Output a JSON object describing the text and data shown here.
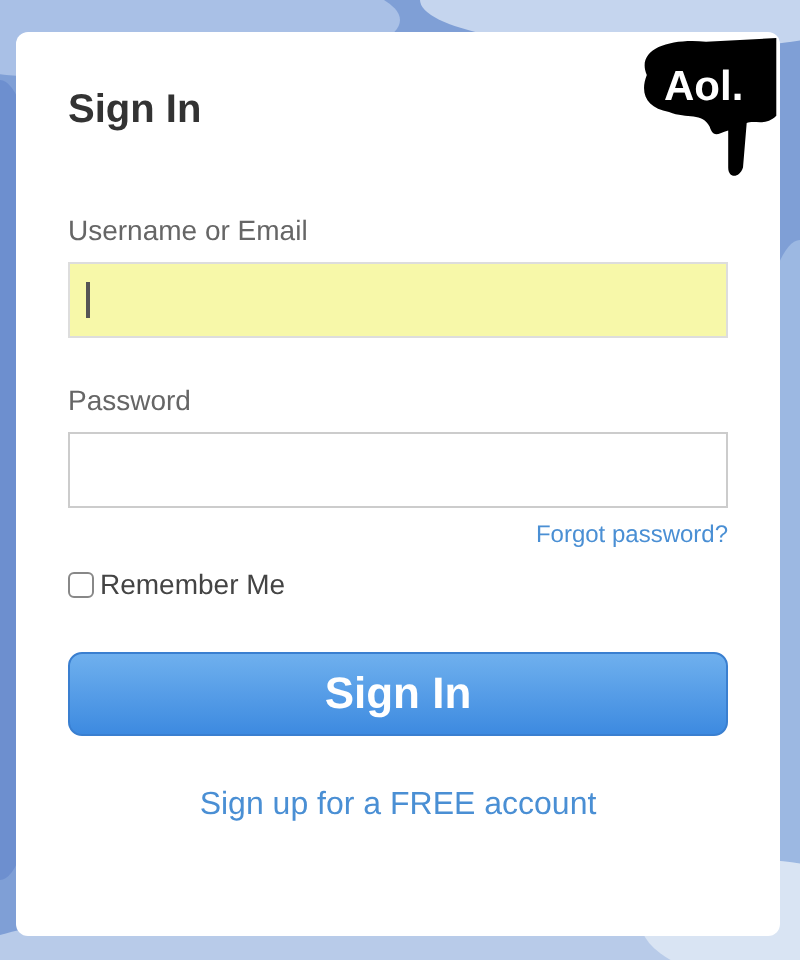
{
  "logo": {
    "text": "Aol."
  },
  "title": "Sign In",
  "fields": [
    {
      "label": "Username or Email",
      "focused": true
    },
    {
      "label": "Password",
      "focused": false
    }
  ],
  "forgot_link": "Forgot password?",
  "remember": {
    "label": "Remember Me",
    "checked": false
  },
  "submit_button": "Sign In",
  "signup_link": "Sign up for a FREE account"
}
